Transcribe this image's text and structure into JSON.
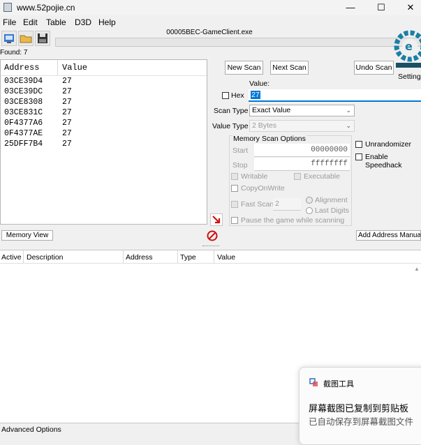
{
  "window": {
    "title": "www.52pojie.cn"
  },
  "window_controls": {
    "minimize": "—",
    "maximize": "☐",
    "close": "✕"
  },
  "menu": [
    "File",
    "Edit",
    "Table",
    "D3D",
    "Help"
  ],
  "process_name": "00005BEC-GameClient.exe",
  "found_label": "Found: 7",
  "results": {
    "headers": {
      "address": "Address",
      "value": "Value"
    },
    "rows": [
      {
        "address": "03CE39D4",
        "value": "27"
      },
      {
        "address": "03CE39DC",
        "value": "27"
      },
      {
        "address": "03CE8308",
        "value": "27"
      },
      {
        "address": "03CE831C",
        "value": "27"
      },
      {
        "address": "0F4377A6",
        "value": "27"
      },
      {
        "address": "0F4377AE",
        "value": "27"
      },
      {
        "address": "25DFF7B4",
        "value": "27"
      }
    ]
  },
  "scan": {
    "new_scan": "New Scan",
    "next_scan": "Next Scan",
    "undo_scan": "Undo Scan",
    "settings": "Settings",
    "value_label": "Value:",
    "hex_label": "Hex",
    "value": "27",
    "scan_type_label": "Scan Type",
    "scan_type_value": "Exact Value",
    "value_type_label": "Value Type",
    "value_type_value": "2 Bytes",
    "mem_options_title": "Memory Scan Options",
    "start_label": "Start",
    "start_value": "00000000",
    "stop_label": "Stop",
    "stop_value": "ffffffff",
    "writable": "Writable",
    "executable": "Executable",
    "copy_on_write": "CopyOnWrite",
    "fast_scan": "Fast Scan",
    "fast_scan_value": "2",
    "alignment": "Alignment",
    "last_digits": "Last Digits",
    "pause": "Pause the game while scanning",
    "unrandomizer": "Unrandomizer",
    "speedhack": "Enable Speedhack"
  },
  "memory_view": "Memory View",
  "add_address": "Add Address Manually",
  "address_list": {
    "headers": [
      "Active",
      "Description",
      "Address",
      "Type",
      "Value"
    ]
  },
  "advanced_options": "Advanced Options",
  "toast": {
    "app": "截图工具",
    "title": "屏幕截图已复制到剪贴板",
    "body": "已自动保存到屏幕截图文件"
  },
  "colors": {
    "accent": "#0078d7",
    "logo": "#1b7fa6",
    "stop_icon": "#d01010"
  }
}
